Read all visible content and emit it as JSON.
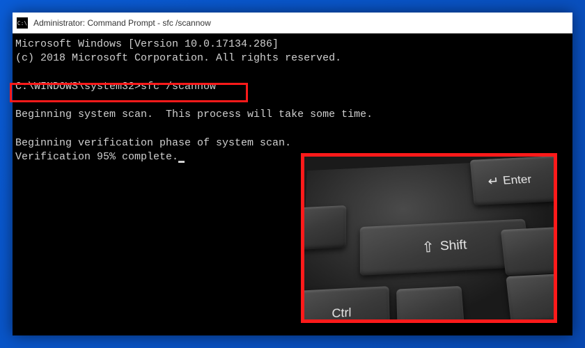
{
  "titlebar": {
    "icon_label": "C:\\",
    "title": "Administrator: Command Prompt - sfc  /scannow"
  },
  "terminal": {
    "line1": "Microsoft Windows [Version 10.0.17134.286]",
    "line2": "(c) 2018 Microsoft Corporation. All rights reserved.",
    "blank1": " ",
    "prompt_line": "C:\\WINDOWS\\system32>sfc /scannow",
    "blank2": " ",
    "line3": "Beginning system scan.  This process will take some time.",
    "blank3": " ",
    "line4": "Beginning verification phase of system scan.",
    "line5_prefix": "Verification 95% complete."
  },
  "keyboard": {
    "shift_label": "Shift",
    "enter_label": "Enter",
    "ctrl_label": "Ctrl"
  }
}
